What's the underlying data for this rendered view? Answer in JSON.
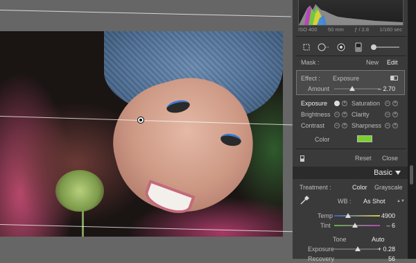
{
  "histogram": {
    "iso": "ISO 400",
    "focal": "50 mm",
    "aperture": "ƒ / 2.8",
    "shutter": "1/160 sec"
  },
  "tools": [
    "crop-overlay-icon",
    "spot-removal-icon",
    "red-eye-icon",
    "graduated-filter-icon",
    "adjustment-brush-icon"
  ],
  "mask": {
    "label": "Mask :",
    "new_label": "New",
    "edit_label": "Edit"
  },
  "effect": {
    "label": "Effect :",
    "value": "Exposure",
    "amount_label": "Amount",
    "amount_value": "– 2.70",
    "amount_level": 0.4
  },
  "adjustments": {
    "left": [
      {
        "label": "Exposure"
      },
      {
        "label": "Brightness"
      },
      {
        "label": "Contrast"
      }
    ],
    "right": [
      {
        "label": "Saturation"
      },
      {
        "label": "Clarity"
      },
      {
        "label": "Sharpness"
      }
    ],
    "color_label": "Color",
    "color_swatch": "#7bd12b"
  },
  "footer": {
    "reset_label": "Reset",
    "close_label": "Close"
  },
  "basic": {
    "title": "Basic",
    "treatment_label": "Treatment :",
    "color_label": "Color",
    "grayscale_label": "Grayscale",
    "wb_label": "WB :",
    "wb_value": "As Shot",
    "temp_label": "Temp",
    "temp_value": "4900",
    "temp_level": 0.3,
    "tint_label": "Tint",
    "tint_value": "– 6",
    "tint_level": 0.45,
    "tone_label": "Tone",
    "auto_label": "Auto",
    "exposure_label": "Exposure",
    "exposure_value": "+ 0.28",
    "exposure_level": 0.52,
    "recovery_label": "Recovery",
    "recovery_value": "56"
  },
  "colors": {
    "panel_bg": "#3a3a3a",
    "accent_green": "#7bd12b"
  }
}
